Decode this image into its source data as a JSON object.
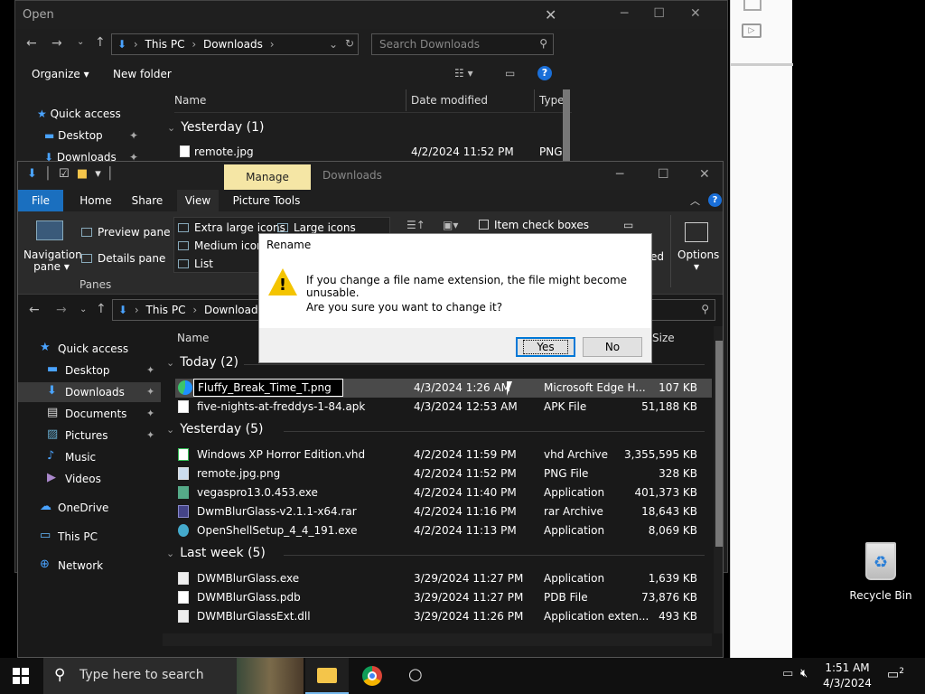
{
  "open_dialog": {
    "title": "Open",
    "path": [
      "This PC",
      "Downloads"
    ],
    "search_placeholder": "Search Downloads",
    "toolbar": {
      "organize": "Organize",
      "new_folder": "New folder"
    },
    "sidebar": [
      "Quick access",
      "Desktop",
      "Downloads"
    ],
    "columns": {
      "name": "Name",
      "date": "Date modified",
      "type": "Type"
    },
    "group": "Yesterday (1)",
    "file": {
      "name": "remote.jpg",
      "date": "4/2/2024 11:52 PM",
      "type": "PNG"
    }
  },
  "explorer": {
    "contextual_tab": "Manage",
    "title": "Downloads",
    "tabs": [
      "File",
      "Home",
      "Share",
      "View",
      "Picture Tools"
    ],
    "ribbon": {
      "navigation_pane": "Navigation pane",
      "preview_pane": "Preview pane",
      "details_pane": "Details pane",
      "panes_group": "Panes",
      "layouts": [
        "Extra large icons",
        "Large icons",
        "Medium icons",
        "List"
      ],
      "item_check_boxes": "Item check boxes",
      "hidden_label": "ed",
      "options": "Options"
    },
    "path": [
      "This PC",
      "Downloads"
    ],
    "sidebar": [
      "Quick access",
      "Desktop",
      "Downloads",
      "Documents",
      "Pictures",
      "Music",
      "Videos",
      "OneDrive",
      "This PC",
      "Network"
    ],
    "columns": {
      "name": "Name",
      "size": "Size"
    },
    "groups": {
      "today": "Today (2)",
      "yesterday": "Yesterday (5)",
      "lastweek": "Last week (5)"
    },
    "today": [
      {
        "name": "Fluffy_Break_Time_T.png",
        "date": "4/3/2024 1:26 AM",
        "type": "Microsoft Edge H...",
        "size": "107 KB"
      },
      {
        "name": "five-nights-at-freddys-1-84.apk",
        "date": "4/3/2024 12:53 AM",
        "type": "APK File",
        "size": "51,188 KB"
      }
    ],
    "yesterday": [
      {
        "name": "Windows XP Horror Edition.vhd",
        "date": "4/2/2024 11:59 PM",
        "type": "vhd Archive",
        "size": "3,355,595 KB"
      },
      {
        "name": "remote.jpg.png",
        "date": "4/2/2024 11:52 PM",
        "type": "PNG File",
        "size": "328 KB"
      },
      {
        "name": "vegaspro13.0.453.exe",
        "date": "4/2/2024 11:40 PM",
        "type": "Application",
        "size": "401,373 KB"
      },
      {
        "name": "DwmBlurGlass-v2.1.1-x64.rar",
        "date": "4/2/2024 11:16 PM",
        "type": "rar Archive",
        "size": "18,643 KB"
      },
      {
        "name": "OpenShellSetup_4_4_191.exe",
        "date": "4/2/2024 11:13 PM",
        "type": "Application",
        "size": "8,069 KB"
      }
    ],
    "lastweek": [
      {
        "name": "DWMBlurGlass.exe",
        "date": "3/29/2024 11:27 PM",
        "type": "Application",
        "size": "1,639 KB"
      },
      {
        "name": "DWMBlurGlass.pdb",
        "date": "3/29/2024 11:27 PM",
        "type": "PDB File",
        "size": "73,876 KB"
      },
      {
        "name": "DWMBlurGlassExt.dll",
        "date": "3/29/2024 11:26 PM",
        "type": "Application exten...",
        "size": "493 KB"
      }
    ]
  },
  "rename_dialog": {
    "title": "Rename",
    "message1": "If you change a file name extension, the file might become unusable.",
    "message2": "Are you sure you want to change it?",
    "yes": "Yes",
    "no": "No"
  },
  "desktop": {
    "recycle_bin": "Recycle Bin"
  },
  "taskbar": {
    "search_placeholder": "Type here to search",
    "time": "1:51 AM",
    "date": "4/3/2024",
    "notifications": "2"
  }
}
